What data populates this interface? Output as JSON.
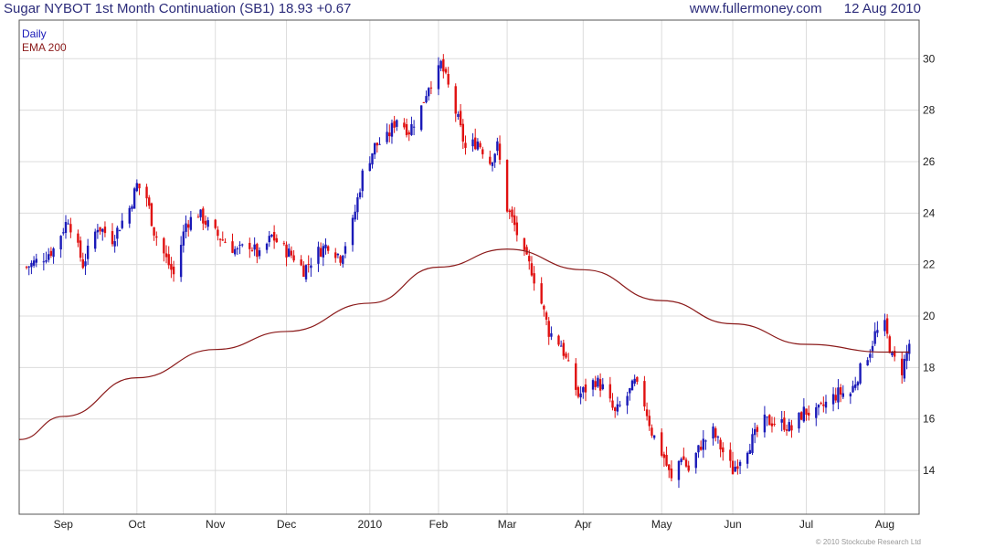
{
  "header": {
    "symbol": "Sugar NYBOT 1st Month Continuation (SB1)",
    "price": "18.93",
    "change": "+0.67",
    "site": "www.fullermoney.com",
    "date": "12 Aug 2010"
  },
  "copyright": "© 2010 Stockcube Research Ltd",
  "chart_data": {
    "type": "candlestick",
    "legend": [
      {
        "label": "Daily",
        "color": "#1a1ab8"
      },
      {
        "label": "EMA 200",
        "color": "#8b1a1a"
      }
    ],
    "colors": {
      "up": "#1a1ab8",
      "down": "#e01010",
      "ema": "#8b1a1a",
      "grid": "#dcdcdc"
    },
    "y_ticks": [
      14,
      16,
      18,
      20,
      22,
      24,
      26,
      28,
      30
    ],
    "ylim": [
      12.3,
      31.5
    ],
    "grid": true,
    "x_ticks": [
      {
        "label": "Sep",
        "date": "2009-09-01"
      },
      {
        "label": "Oct",
        "date": "2009-10-01"
      },
      {
        "label": "Nov",
        "date": "2009-11-02"
      },
      {
        "label": "Dec",
        "date": "2009-12-01"
      },
      {
        "label": "2010",
        "date": "2010-01-04"
      },
      {
        "label": "Feb",
        "date": "2010-02-01"
      },
      {
        "label": "Mar",
        "date": "2010-03-01"
      },
      {
        "label": "Apr",
        "date": "2010-04-01"
      },
      {
        "label": "May",
        "date": "2010-05-03"
      },
      {
        "label": "Jun",
        "date": "2010-06-01"
      },
      {
        "label": "Jul",
        "date": "2010-07-01"
      },
      {
        "label": "Aug",
        "date": "2010-08-02"
      }
    ],
    "x_range": [
      "2009-08-14",
      "2010-08-16"
    ],
    "close_path": [
      [
        "2009-08-17",
        21.9
      ],
      [
        "2009-08-24",
        22.3
      ],
      [
        "2009-08-28",
        22.6
      ],
      [
        "2009-09-03",
        23.8
      ],
      [
        "2009-09-09",
        22.0
      ],
      [
        "2009-09-15",
        23.5
      ],
      [
        "2009-09-21",
        23.0
      ],
      [
        "2009-09-28",
        24.2
      ],
      [
        "2009-10-01",
        25.1
      ],
      [
        "2009-10-05",
        24.6
      ],
      [
        "2009-10-08",
        23.3
      ],
      [
        "2009-10-13",
        22.2
      ],
      [
        "2009-10-16",
        21.6
      ],
      [
        "2009-10-21",
        23.6
      ],
      [
        "2009-10-26",
        24.0
      ],
      [
        "2009-11-02",
        23.2
      ],
      [
        "2009-11-06",
        22.9
      ],
      [
        "2009-11-11",
        22.5
      ],
      [
        "2009-11-16",
        22.8
      ],
      [
        "2009-11-20",
        22.3
      ],
      [
        "2009-11-25",
        23.1
      ],
      [
        "2009-11-30",
        22.6
      ],
      [
        "2009-12-04",
        22.3
      ],
      [
        "2009-12-08",
        21.8
      ],
      [
        "2009-12-14",
        22.5
      ],
      [
        "2009-12-18",
        22.8
      ],
      [
        "2009-12-23",
        22.3
      ],
      [
        "2009-12-28",
        23.6
      ],
      [
        "2010-01-01",
        25.5
      ],
      [
        "2010-01-06",
        26.6
      ],
      [
        "2010-01-11",
        26.9
      ],
      [
        "2010-01-15",
        27.7
      ],
      [
        "2010-01-20",
        27.2
      ],
      [
        "2010-01-25",
        28.1
      ],
      [
        "2010-01-28",
        29.0
      ],
      [
        "2010-02-01",
        29.5
      ],
      [
        "2010-02-02",
        29.8
      ],
      [
        "2010-02-05",
        28.9
      ],
      [
        "2010-02-09",
        27.6
      ],
      [
        "2010-02-12",
        26.5
      ],
      [
        "2010-02-17",
        26.8
      ],
      [
        "2010-02-22",
        26.0
      ],
      [
        "2010-02-25",
        26.6
      ],
      [
        "2010-03-01",
        24.2
      ],
      [
        "2010-03-04",
        23.5
      ],
      [
        "2010-03-08",
        22.3
      ],
      [
        "2010-03-11",
        21.8
      ],
      [
        "2010-03-15",
        20.5
      ],
      [
        "2010-03-18",
        19.4
      ],
      [
        "2010-03-23",
        18.9
      ],
      [
        "2010-03-26",
        18.0
      ],
      [
        "2010-03-30",
        16.9
      ],
      [
        "2010-04-06",
        17.5
      ],
      [
        "2010-04-09",
        17.2
      ],
      [
        "2010-04-14",
        16.2
      ],
      [
        "2010-04-19",
        16.9
      ],
      [
        "2010-04-22",
        17.4
      ],
      [
        "2010-04-26",
        16.6
      ],
      [
        "2010-04-29",
        15.5
      ],
      [
        "2010-05-04",
        14.5
      ],
      [
        "2010-05-07",
        13.6
      ],
      [
        "2010-05-11",
        14.6
      ],
      [
        "2010-05-14",
        14.0
      ],
      [
        "2010-05-19",
        15.0
      ],
      [
        "2010-05-24",
        15.5
      ],
      [
        "2010-05-27",
        14.9
      ],
      [
        "2010-06-01",
        14.0
      ],
      [
        "2010-06-04",
        14.5
      ],
      [
        "2010-06-09",
        15.2
      ],
      [
        "2010-06-14",
        15.9
      ],
      [
        "2010-06-17",
        15.9
      ],
      [
        "2010-06-22",
        15.8
      ],
      [
        "2010-06-25",
        15.6
      ],
      [
        "2010-06-30",
        16.3
      ],
      [
        "2010-07-05",
        16.2
      ],
      [
        "2010-07-09",
        16.6
      ],
      [
        "2010-07-14",
        17.0
      ],
      [
        "2010-07-19",
        17.0
      ],
      [
        "2010-07-22",
        17.7
      ],
      [
        "2010-07-27",
        18.7
      ],
      [
        "2010-07-29",
        19.3
      ],
      [
        "2010-08-02",
        19.6
      ],
      [
        "2010-08-05",
        18.4
      ],
      [
        "2010-08-09",
        17.9
      ],
      [
        "2010-08-12",
        18.93
      ]
    ],
    "ema_path": [
      [
        "2009-08-14",
        15.2
      ],
      [
        "2009-09-01",
        16.1
      ],
      [
        "2009-10-01",
        17.6
      ],
      [
        "2009-11-02",
        18.7
      ],
      [
        "2009-12-01",
        19.4
      ],
      [
        "2010-01-04",
        20.5
      ],
      [
        "2010-02-01",
        21.9
      ],
      [
        "2010-03-01",
        22.6
      ],
      [
        "2010-04-01",
        21.8
      ],
      [
        "2010-05-03",
        20.6
      ],
      [
        "2010-06-01",
        19.7
      ],
      [
        "2010-07-01",
        18.9
      ],
      [
        "2010-08-02",
        18.6
      ],
      [
        "2010-08-12",
        18.6
      ]
    ]
  }
}
